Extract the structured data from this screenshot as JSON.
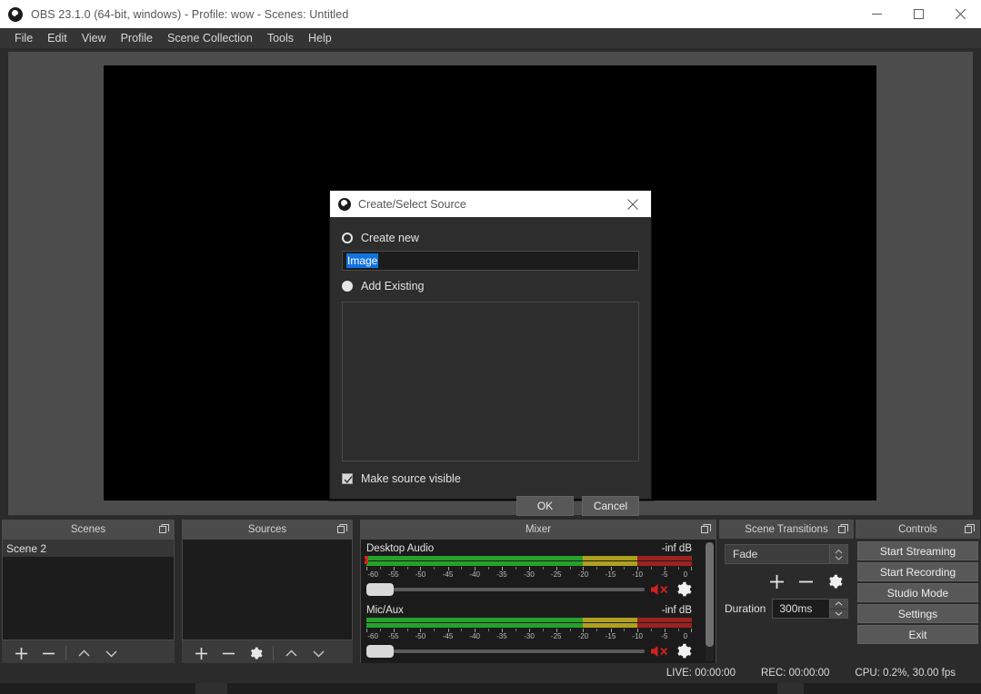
{
  "window": {
    "title": "OBS 23.1.0 (64-bit, windows) - Profile: wow - Scenes: Untitled",
    "icon": "obs-logo-icon",
    "controls": {
      "minimize": "minimize-icon",
      "maximize": "maximize-icon",
      "close": "close-icon"
    }
  },
  "menubar": {
    "items": [
      {
        "label": "File"
      },
      {
        "label": "Edit"
      },
      {
        "label": "View"
      },
      {
        "label": "Profile"
      },
      {
        "label": "Scene Collection"
      },
      {
        "label": "Tools"
      },
      {
        "label": "Help"
      }
    ]
  },
  "scenes": {
    "title": "Scenes",
    "items": [
      {
        "label": "Scene 2",
        "selected": true
      }
    ],
    "toolbar": [
      {
        "name": "add-scene-button",
        "icon": "plus-icon"
      },
      {
        "name": "remove-scene-button",
        "icon": "minus-icon"
      },
      {
        "name": "move-scene-up-button",
        "icon": "chevron-up-icon"
      },
      {
        "name": "move-scene-down-button",
        "icon": "chevron-down-icon"
      }
    ]
  },
  "sources": {
    "title": "Sources",
    "items": [],
    "toolbar": [
      {
        "name": "add-source-button",
        "icon": "plus-icon"
      },
      {
        "name": "remove-source-button",
        "icon": "minus-icon"
      },
      {
        "name": "source-properties-button",
        "icon": "gear-icon"
      },
      {
        "name": "move-source-up-button",
        "icon": "chevron-up-icon"
      },
      {
        "name": "move-source-down-button",
        "icon": "chevron-down-icon"
      }
    ]
  },
  "mixer": {
    "title": "Mixer",
    "scale_labels": [
      "-60",
      "-55",
      "-50",
      "-45",
      "-40",
      "-35",
      "-30",
      "-25",
      "-20",
      "-15",
      "-10",
      "-5",
      "0"
    ],
    "channels": [
      {
        "name": "Desktop Audio",
        "level": "-inf dB",
        "muted": true,
        "volume_percent": 0,
        "has_peak_indicator": true
      },
      {
        "name": "Mic/Aux",
        "level": "-inf dB",
        "muted": true,
        "volume_percent": 0,
        "has_peak_indicator": false
      }
    ]
  },
  "scene_transitions": {
    "title": "Scene Transitions",
    "selected_transition": "Fade",
    "buttons": [
      {
        "name": "add-transition-button",
        "icon": "plus-icon"
      },
      {
        "name": "remove-transition-button",
        "icon": "minus-icon"
      },
      {
        "name": "transition-properties-button",
        "icon": "gear-icon"
      }
    ],
    "duration_label": "Duration",
    "duration_value": "300ms"
  },
  "controls": {
    "title": "Controls",
    "buttons": [
      {
        "label": "Start Streaming",
        "name": "start-streaming-button"
      },
      {
        "label": "Start Recording",
        "name": "start-recording-button"
      },
      {
        "label": "Studio Mode",
        "name": "studio-mode-button"
      },
      {
        "label": "Settings",
        "name": "settings-button"
      },
      {
        "label": "Exit",
        "name": "exit-button"
      }
    ]
  },
  "statusbar": {
    "live": "LIVE: 00:00:00",
    "rec": "REC: 00:00:00",
    "cpu": "CPU: 0.2%, 30.00 fps"
  },
  "dialog": {
    "title": "Create/Select Source",
    "icon": "obs-logo-icon",
    "close_icon": "close-icon",
    "create_new_label": "Create new",
    "create_new_selected": true,
    "source_name_value": "Image",
    "source_name_placeholder": "",
    "add_existing_label": "Add Existing",
    "add_existing_selected": false,
    "existing_sources": [],
    "make_visible_label": "Make source visible",
    "make_visible_checked": true,
    "ok_label": "OK",
    "cancel_label": "Cancel"
  },
  "colors": {
    "accent_selection": "#1273de",
    "meter_green": "#26a12a",
    "meter_yellow": "#b0a020",
    "meter_red": "#9c2222",
    "peak_red": "#e02020",
    "dock_title_bg": "#4b4b4b",
    "preview_bg": "#4c4c4c",
    "canvas_black": "#000000"
  }
}
